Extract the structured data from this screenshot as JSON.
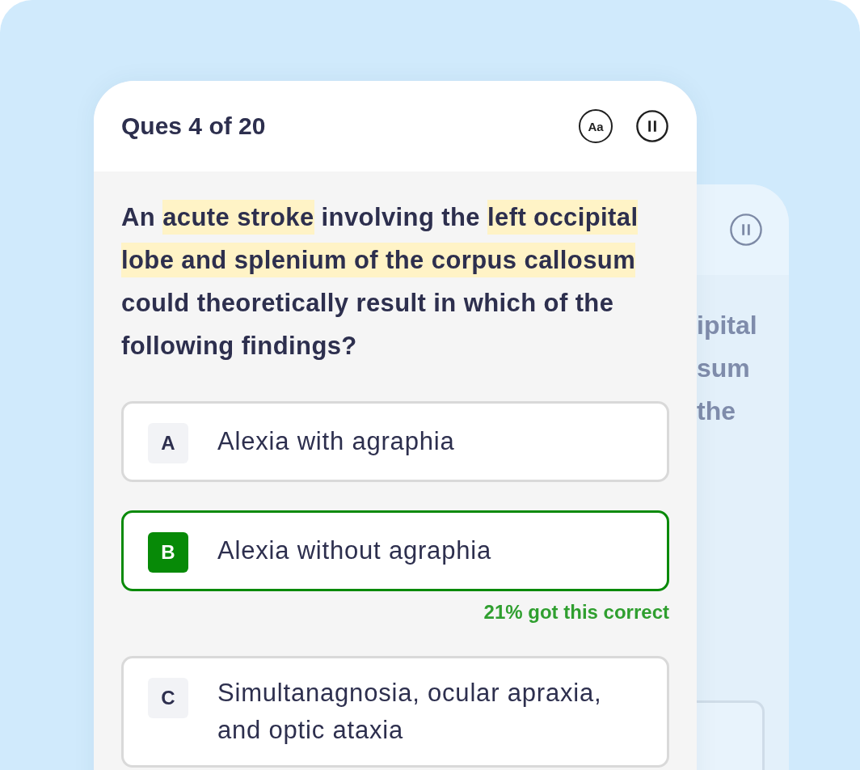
{
  "back_card": {
    "fragments": [
      "ipital",
      "sum",
      "the"
    ]
  },
  "header": {
    "title": "Ques 4 of 20",
    "font_button": "Aa"
  },
  "question": [
    {
      "text": "An ",
      "highlighted": false
    },
    {
      "text": "acute stroke",
      "highlighted": true
    },
    {
      "text": " involving the ",
      "highlighted": false
    },
    {
      "text": "left occipital lobe and splenium of the corpus callosum",
      "highlighted": true
    },
    {
      "text": " could theoretically result in which of the following findings?",
      "highlighted": false
    }
  ],
  "options": [
    {
      "letter": "A",
      "text": "Alexia with agraphia",
      "correct": false
    },
    {
      "letter": "B",
      "text": "Alexia without agraphia",
      "correct": true,
      "stat": "21% got this correct"
    },
    {
      "letter": "C",
      "text": "Simultanagnosia, ocular apraxia, and optic ataxia",
      "correct": false
    }
  ]
}
